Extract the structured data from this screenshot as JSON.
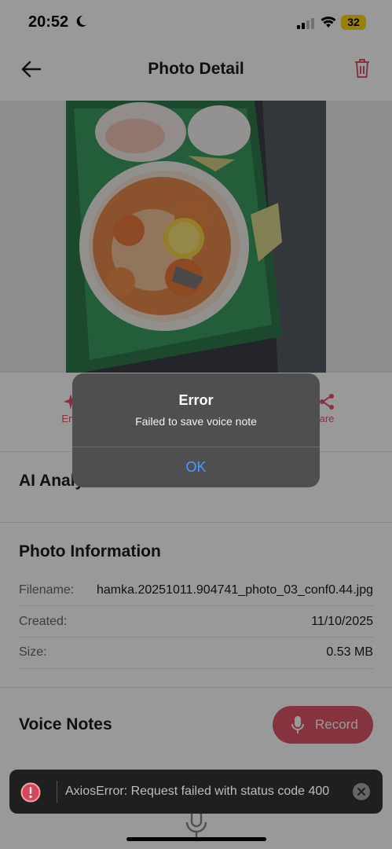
{
  "status_bar": {
    "time": "20:52",
    "battery": "32",
    "icons": [
      "moon-icon",
      "signal-icon",
      "wifi-icon",
      "battery-icon"
    ]
  },
  "header": {
    "title": "Photo Detail",
    "back_icon": "arrow-left-icon",
    "delete_icon": "trash-icon"
  },
  "actions": [
    {
      "label": "Enh",
      "icon": "sparkle-icon"
    },
    {
      "label": "are",
      "icon": "share-icon"
    }
  ],
  "ai_analysis": {
    "title": "AI Analy"
  },
  "photo_info": {
    "title": "Photo Information",
    "rows": [
      {
        "label": "Filename:",
        "value": "hamka.20251011.904741_photo_03_conf0.44.jpg"
      },
      {
        "label": "Created:",
        "value": "11/10/2025"
      },
      {
        "label": "Size:",
        "value": "0.53 MB"
      }
    ]
  },
  "voice_notes": {
    "title": "Voice Notes",
    "record_label": "Record",
    "record_icon": "mic-icon"
  },
  "alert": {
    "title": "Error",
    "message": "Failed to save voice note",
    "ok_label": "OK"
  },
  "toast": {
    "message": "AxiosError: Request failed with status code 400",
    "icon": "error-circle-icon",
    "close_icon": "close-icon"
  },
  "colors": {
    "accent": "#e0566c",
    "alert_bg": "#4f4f51",
    "ok_blue": "#4a9bff",
    "toast_bg": "#1f1f1f"
  }
}
